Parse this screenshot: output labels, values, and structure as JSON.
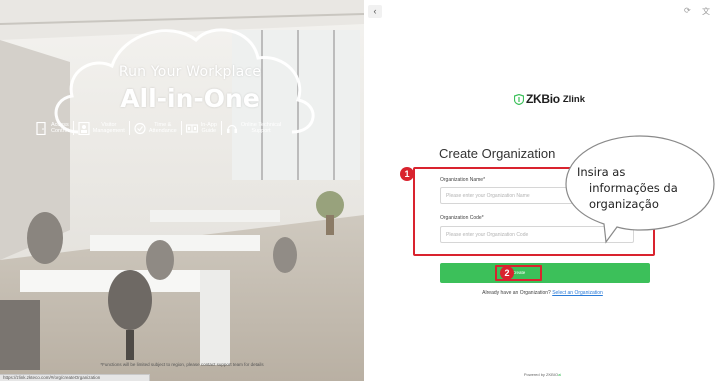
{
  "promo": {
    "headline_top": "Run Your Workplace",
    "headline_main": "All-in-One",
    "features": [
      {
        "line1": "Access",
        "line2": "Control",
        "icon": "door-icon"
      },
      {
        "line1": "Visitor",
        "line2": "Management",
        "icon": "visitor-icon"
      },
      {
        "line1": "Time &",
        "line2": "Attendance",
        "icon": "clock-icon"
      },
      {
        "line1": "In-App",
        "line2": "Guide",
        "icon": "book-icon"
      },
      {
        "line1": "Online Technical",
        "line2": "Support",
        "icon": "headset-icon"
      }
    ],
    "footnote": "*Functions will be limited subject to region, please contact support team for details",
    "status_url": "https://zlink.zkteco.com/#/org/createOrganization"
  },
  "header": {
    "back_icon": "‹",
    "refresh_icon": "⟳",
    "translate_icon": "文"
  },
  "brand": {
    "zk": "ZK",
    "bio": "Bio",
    "zlink": "Zlink"
  },
  "form": {
    "title": "Create Organization",
    "org_name_label": "Organization Name*",
    "org_name_placeholder": "Please enter your Organization Name",
    "org_code_label": "Organization Code*",
    "org_code_placeholder": "Please enter your Organization Code",
    "create_label": "Create",
    "already_text": "Already have an Organization?",
    "select_link": "Select an Organization",
    "powered_prefix": "Powered by ",
    "powered_brand_a": "ZKBIO",
    "powered_brand_b": "ai"
  },
  "annotations": {
    "marker1": "1",
    "marker2": "2",
    "bubble_line1": "Insira as",
    "bubble_line2": "informações da",
    "bubble_line3": "organização"
  },
  "colors": {
    "accent_green": "#3cc05a",
    "highlight_red": "#d9232e",
    "link_blue": "#2a7bd8"
  }
}
